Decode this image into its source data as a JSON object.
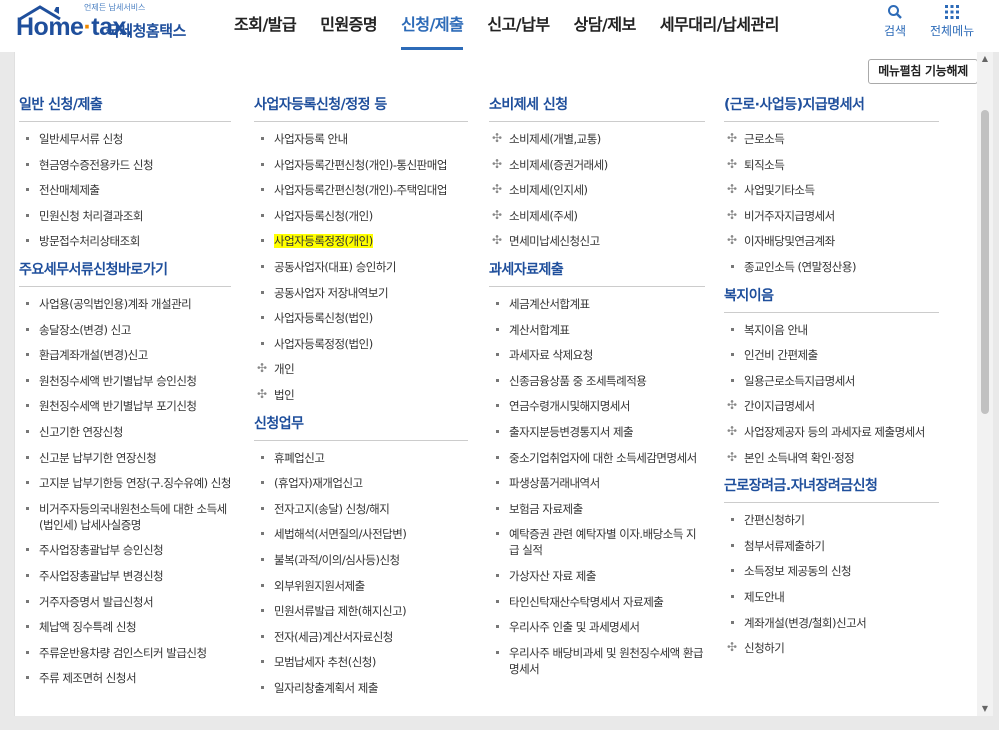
{
  "header": {
    "logo_tagline": "언제든 납세서비스",
    "logo_brand_a": "Home",
    "logo_brand_dot": "·",
    "logo_brand_b": "tax.",
    "logo_brand_kr": "국세청홈택스",
    "nav": [
      "조회/발급",
      "민원증명",
      "신청/제출",
      "신고/납부",
      "상담/제보",
      "세무대리/납세관리"
    ],
    "active_nav": "신청/제출",
    "search_label": "검색",
    "all_menu_label": "전체메뉴"
  },
  "panel": {
    "fold_button": "메뉴펼침 기능해제",
    "columns": [
      {
        "sections": [
          {
            "title": "일반 신청/제출",
            "bullet": "square",
            "items": [
              "일반세무서류 신청",
              "현금영수증전용카드 신청",
              "전산매체제출",
              "민원신청 처리결과조회",
              "방문접수처리상태조회"
            ]
          },
          {
            "title": "주요세무서류신청바로가기",
            "bullet": "square",
            "items": [
              "사업용(공익법인용)계좌 개설관리",
              "송달장소(변경) 신고",
              "환급계좌개설(변경)신고",
              "원천징수세액 반기별납부 승인신청",
              "원천징수세액 반기별납부 포기신청",
              "신고기한 연장신청",
              "신고분 납부기한 연장신청",
              "고지분 납부기한등 연장(구.징수유예) 신청",
              "비거주자등의국내원천소득에 대한 소득세(법인세) 납세사실증명",
              "주사업장총괄납부 승인신청",
              "주사업장총괄납부 변경신청",
              "거주자증명서 발급신청서",
              "체납액 징수특례 신청",
              "주류운반용차량 검인스티커 발급신청",
              "주류 제조면허 신청서"
            ]
          }
        ]
      },
      {
        "sections": [
          {
            "title": "사업자등록신청/정정 등",
            "bullet": "square",
            "items": [
              "사업자등록 안내",
              "사업자등록간편신청(개인)-통신판매업",
              "사업자등록간편신청(개인)-주택임대업",
              "사업자등록신청(개인)",
              "사업자등록정정(개인)",
              "공동사업자(대표) 승인하기",
              "공동사업자 저장내역보기",
              "사업자등록신청(법인)",
              "사업자등록정정(법인)"
            ],
            "highlight_index": 4,
            "extra_cross_items": [
              "개인",
              "법인"
            ]
          },
          {
            "title": "신청업무",
            "bullet": "square",
            "items": [
              "휴폐업신고",
              "(휴업자)재개업신고",
              "전자고지(송달) 신청/해지",
              "세법해석(서면질의/사전답변)",
              "불복(과적/이의/심사등)신청",
              "외부위원지원서제출",
              "민원서류발급 제한(해지신고)",
              "전자(세금)계산서자료신청",
              "모범납세자 추천(신청)",
              "일자리창출계획서 제출"
            ]
          }
        ]
      },
      {
        "sections": [
          {
            "title": "소비제세 신청",
            "bullet": "cross",
            "items": [
              "소비제세(개별,교통)",
              "소비제세(증권거래세)",
              "소비제세(인지세)",
              "소비제세(주세)",
              "면세미납세신청신고"
            ]
          },
          {
            "title": "과세자료제출",
            "bullet": "square",
            "items": [
              "세금계산서합계표",
              "계산서합계표",
              "과세자료 삭제요청",
              "신종금융상품 중 조세특례적용",
              "연금수령개시및해지명세서",
              "출자지분등변경통지서 제출",
              "중소기업취업자에 대한 소득세감면명세서",
              "파생상품거래내역서",
              "보험금 자료제출",
              "예탁증권 관련 예탁자별 이자.배당소득 지급 실적",
              "가상자산 자료 제출",
              "타인신탁재산수탁명세서 자료제출",
              "우리사주 인출 및 과세명세서",
              "우리사주 배당비과세 및 원천징수세액 환급명세서"
            ]
          }
        ]
      },
      {
        "sections": [
          {
            "title": "(근로·사업등)지급명세서",
            "bullet": "cross",
            "items": [
              "근로소득",
              "퇴직소득",
              "사업및기타소득",
              "비거주자지급명세서",
              "이자배당및연금계좌",
              "종교인소득 (연말정산용)"
            ],
            "square_from": 5
          },
          {
            "title": "복지이음",
            "bullet": "square",
            "items": [
              "복지이음 안내",
              "인건비 간편제출",
              "일용근로소득지급명세서",
              "간이지급명세서",
              "사업장제공자 등의 과세자료 제출명세서",
              "본인 소득내역 확인·정정"
            ],
            "cross_indices": [
              3,
              4,
              5
            ]
          },
          {
            "title": "근로장려금.자녀장려금신청",
            "bullet": "square",
            "items": [
              "간편신청하기",
              "첨부서류제출하기",
              "소득정보 제공동의 신청",
              "제도안내",
              "계좌개설(변경/철회)신고서",
              "신청하기"
            ],
            "cross_indices": [
              5
            ]
          }
        ]
      }
    ]
  }
}
